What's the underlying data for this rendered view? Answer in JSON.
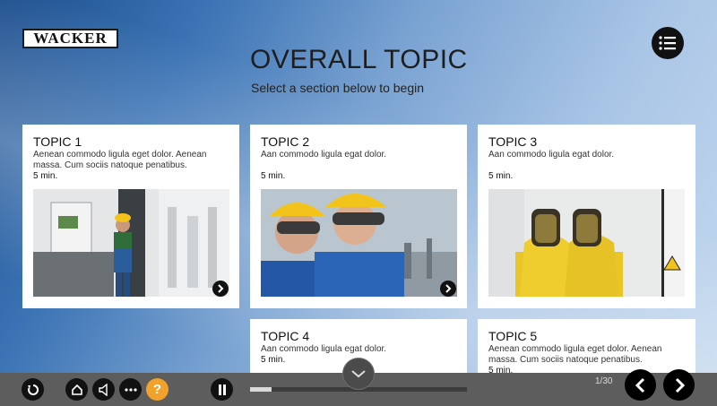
{
  "brand": {
    "logo_text": "WACKER"
  },
  "header": {
    "title": "OVERALL TOPIC",
    "subtitle": "Select a section below to begin"
  },
  "topics": [
    {
      "title": "TOPIC 1",
      "description": "Aenean commodo ligula eget dolor. Aenean massa. Cum sociis natoque penatibus.",
      "duration": "5 min."
    },
    {
      "title": "TOPIC 2",
      "description": "Aan commodo ligula egat dolor.",
      "duration": "5 min."
    },
    {
      "title": "TOPIC 3",
      "description": "Aan commodo ligula egat dolor.",
      "duration": "5 min."
    },
    {
      "title": "TOPIC 4",
      "description": "Aan commodo ligula egat dolor.",
      "duration": "5 min."
    },
    {
      "title": "TOPIC 5",
      "description": "Aenean commodo ligula eget dolor. Aenean massa. Cum sociis natoque penatibus.",
      "duration": "5 min."
    }
  ],
  "player": {
    "page_indicator": "1/30",
    "progress": 0.1
  },
  "icons": {
    "menu": "list-icon",
    "replay": "replay-icon",
    "home": "home-icon",
    "audio": "speaker-icon",
    "more": "more-icon",
    "help": "?",
    "pause": "pause-icon",
    "scroll": "chevron-down-icon",
    "prev": "chevron-left-icon",
    "next": "chevron-right-icon"
  },
  "colors": {
    "help_accent": "#f0a22b",
    "bar": "#5d5d5d"
  }
}
